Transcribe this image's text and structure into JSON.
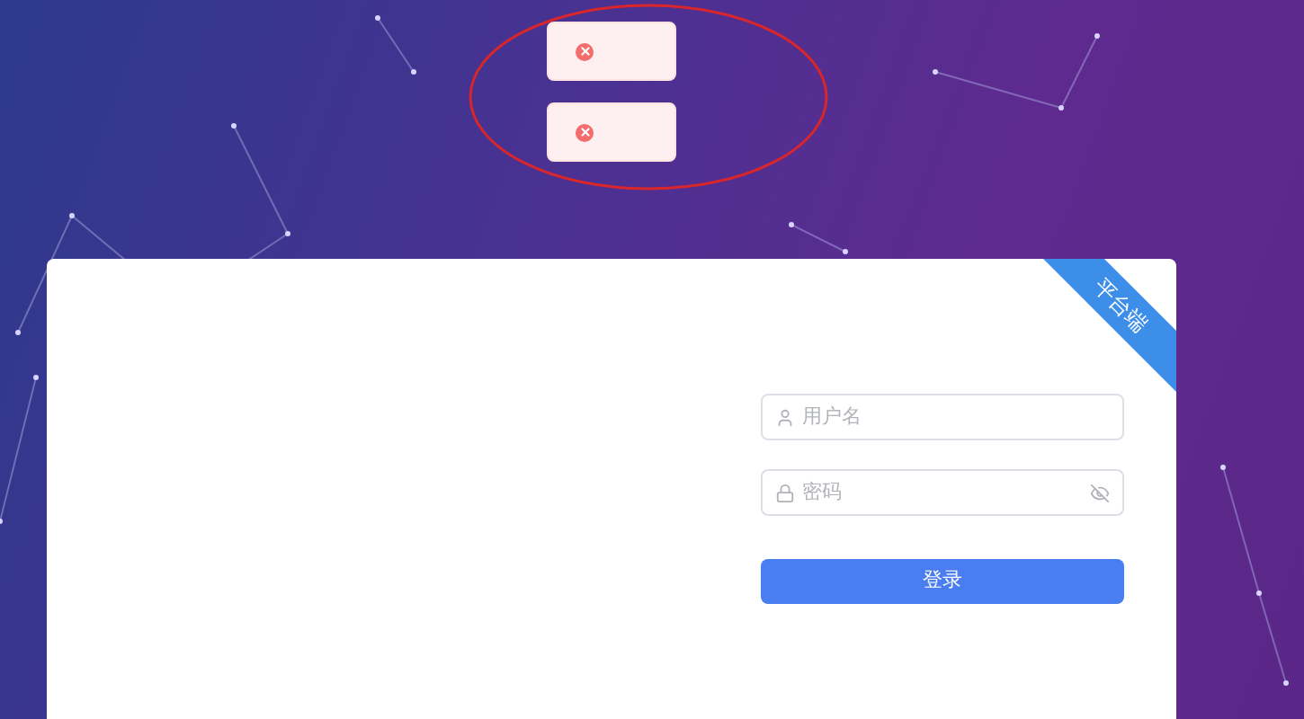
{
  "toasts": [
    {
      "kind": "error"
    },
    {
      "kind": "error"
    }
  ],
  "login": {
    "ribbon": "平台端",
    "username": {
      "placeholder": "用户名"
    },
    "password": {
      "placeholder": "密码"
    },
    "submit": "登录"
  }
}
